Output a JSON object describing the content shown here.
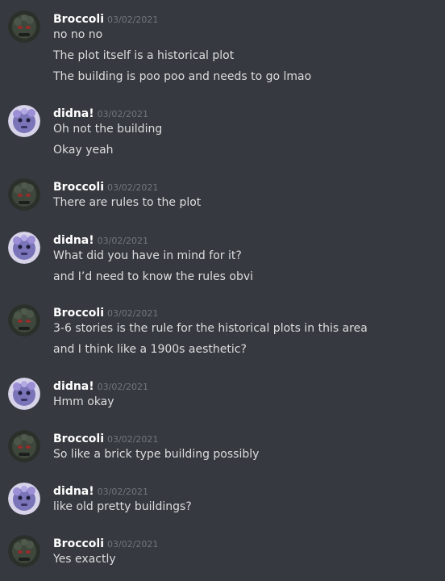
{
  "messages": [
    {
      "author": "Broccoli",
      "avatar_icon": "broccoli-avatar-icon",
      "timestamp": "03/02/2021",
      "lines": [
        "no no no",
        "The plot itself is a historical plot",
        "The building is poo poo and needs to go lmao"
      ]
    },
    {
      "author": "didna!",
      "avatar_icon": "didna-avatar-icon",
      "timestamp": "03/02/2021",
      "lines": [
        "Oh not the building",
        "Okay yeah"
      ]
    },
    {
      "author": "Broccoli",
      "avatar_icon": "broccoli-avatar-icon",
      "timestamp": "03/02/2021",
      "lines": [
        "There are rules to the plot"
      ]
    },
    {
      "author": "didna!",
      "avatar_icon": "didna-avatar-icon",
      "timestamp": "03/02/2021",
      "lines": [
        "What did you have in mind for it?",
        "and I’d need to know the rules obvi"
      ]
    },
    {
      "author": "Broccoli",
      "avatar_icon": "broccoli-avatar-icon",
      "timestamp": "03/02/2021",
      "lines": [
        "3-6 stories is the rule for the historical plots in this area",
        "and I think like a 1900s aesthetic?"
      ]
    },
    {
      "author": "didna!",
      "avatar_icon": "didna-avatar-icon",
      "timestamp": "03/02/2021",
      "lines": [
        "Hmm okay"
      ]
    },
    {
      "author": "Broccoli",
      "avatar_icon": "broccoli-avatar-icon",
      "timestamp": "03/02/2021",
      "lines": [
        "So like a brick type building possibly"
      ]
    },
    {
      "author": "didna!",
      "avatar_icon": "didna-avatar-icon",
      "timestamp": "03/02/2021",
      "lines": [
        "like old pretty buildings?"
      ]
    },
    {
      "author": "Broccoli",
      "avatar_icon": "broccoli-avatar-icon",
      "timestamp": "03/02/2021",
      "lines": [
        "Yes exactly"
      ]
    }
  ],
  "colors": {
    "background": "#36393f",
    "username": "#ffffff",
    "timestamp": "#72767d",
    "message_text": "#dcddde"
  }
}
